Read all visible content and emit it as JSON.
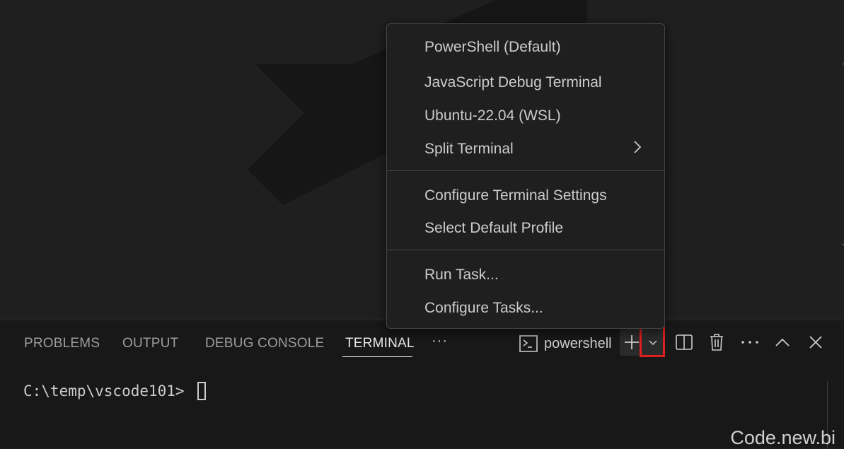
{
  "panel": {
    "tabs": [
      {
        "label": "PROBLEMS",
        "active": false
      },
      {
        "label": "OUTPUT",
        "active": false
      },
      {
        "label": "DEBUG CONSOLE",
        "active": false
      },
      {
        "label": "TERMINAL",
        "active": true
      }
    ],
    "more_tabs_label": "···",
    "terminal_name": "powershell",
    "actions": {
      "new_terminal_icon": "plus-icon",
      "launch_profile_icon": "chevron-down-icon",
      "split_icon": "split-editor-icon",
      "kill_icon": "trash-icon",
      "more_icon": "ellipsis-icon",
      "maximize_icon": "chevron-up-icon",
      "close_icon": "close-icon"
    },
    "highlight_color": "#e01f1f"
  },
  "terminal": {
    "prompt": "C:\\temp\\vscode101>"
  },
  "menu": {
    "items": [
      {
        "label": "PowerShell (Default)"
      },
      {
        "label": "JavaScript Debug Terminal"
      },
      {
        "label": "Ubuntu-22.04 (WSL)"
      },
      {
        "label": "Split Terminal",
        "submenu": true
      },
      {
        "label": "Configure Terminal Settings"
      },
      {
        "label": "Select Default Profile"
      },
      {
        "label": "Run Task..."
      },
      {
        "label": "Configure Tasks..."
      }
    ]
  },
  "watermark": "Code.new.bi",
  "colors": {
    "editor_bg": "#1f1f1f",
    "panel_bg": "#181818",
    "text": "#cccccc",
    "inactive_tab": "#9d9d9d"
  }
}
